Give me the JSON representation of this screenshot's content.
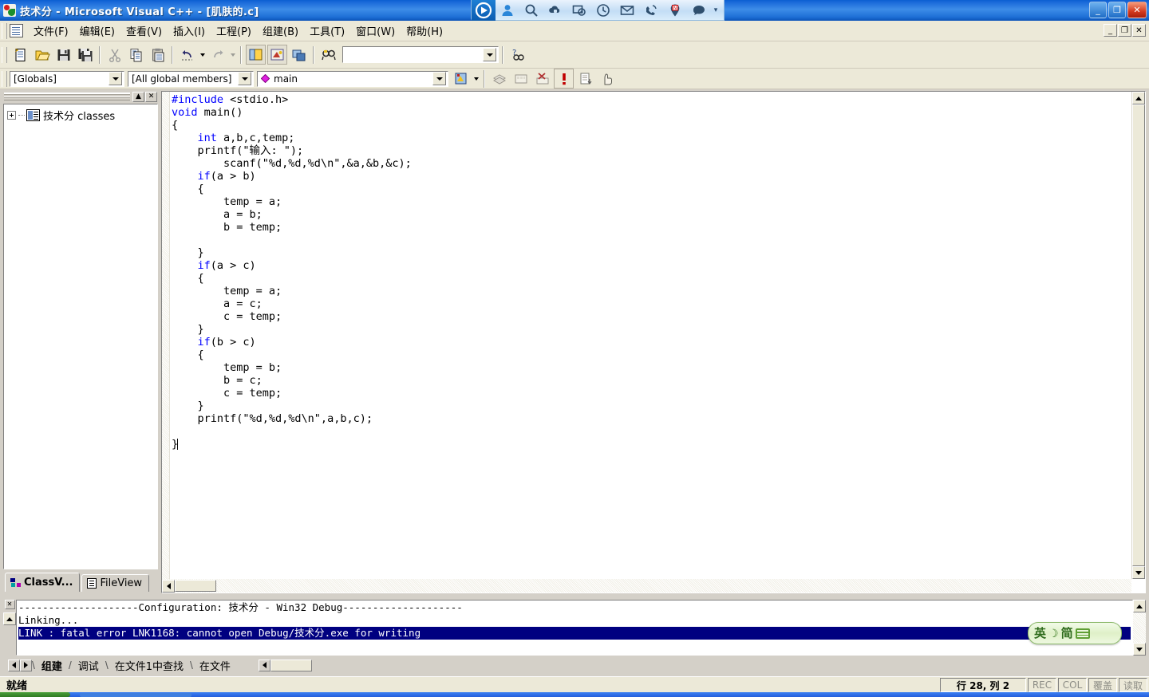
{
  "window": {
    "title": "技术分 - Microsoft Visual C++ - [肌肤的.c]",
    "app_icon": "vc-app-icon",
    "minimize_label": "_",
    "maximize_label": "❐",
    "close_label": "✕",
    "mdi_minimize_label": "_",
    "mdi_restore_label": "❐",
    "mdi_close_label": "✕"
  },
  "qq_toolbar": {
    "icons": [
      {
        "name": "qq-logo-icon",
        "label": "QQ"
      },
      {
        "name": "contact-icon",
        "label": "联系人"
      },
      {
        "name": "search-icon",
        "label": "搜索"
      },
      {
        "name": "cloud-lock-icon",
        "label": "安全"
      },
      {
        "name": "screenshot-icon",
        "label": "截图"
      },
      {
        "name": "clock-icon",
        "label": "时钟"
      },
      {
        "name": "mail-icon",
        "label": "邮件"
      },
      {
        "name": "phone-icon",
        "label": "电话"
      },
      {
        "name": "news-icon",
        "label": "新闻"
      },
      {
        "name": "chat-icon",
        "label": "聊天"
      }
    ],
    "caret_label": "▾"
  },
  "menubar": {
    "items": [
      {
        "label": "文件(F)"
      },
      {
        "label": "编辑(E)"
      },
      {
        "label": "查看(V)"
      },
      {
        "label": "插入(I)"
      },
      {
        "label": "工程(P)"
      },
      {
        "label": "组建(B)"
      },
      {
        "label": "工具(T)"
      },
      {
        "label": "窗口(W)"
      },
      {
        "label": "帮助(H)"
      }
    ]
  },
  "standard_toolbar": {
    "buttons": [
      {
        "name": "new-text-file-button",
        "title": "新建"
      },
      {
        "name": "open-button",
        "title": "打开"
      },
      {
        "name": "save-button",
        "title": "保存"
      },
      {
        "name": "save-all-button",
        "title": "全部保存"
      },
      {
        "name": "cut-button",
        "title": "剪切"
      },
      {
        "name": "copy-button",
        "title": "复制"
      },
      {
        "name": "paste-button",
        "title": "粘贴"
      },
      {
        "name": "undo-button",
        "title": "撤销"
      },
      {
        "name": "redo-button",
        "title": "重做"
      },
      {
        "name": "workspace-toggle-button",
        "title": "工作区"
      },
      {
        "name": "output-toggle-button",
        "title": "输出"
      },
      {
        "name": "window-list-button",
        "title": "窗口列表"
      },
      {
        "name": "find-in-files-button",
        "title": "在文件中查找"
      },
      {
        "name": "help-search-button",
        "title": "搜索帮助"
      }
    ],
    "find_combo_value": "",
    "find_combo_placeholder": ""
  },
  "wizardbar": {
    "class_combo_value": "[Globals]",
    "members_combo_value": "[All global members]",
    "function_combo_value": "main",
    "function_icon": "member-function-icon",
    "action_button": "wizardbar-action-button"
  },
  "build_toolbar": {
    "buttons": [
      {
        "name": "compile-button",
        "enabled": false
      },
      {
        "name": "build-button",
        "enabled": false
      },
      {
        "name": "stop-build-button",
        "enabled": false
      },
      {
        "name": "execute-program-button",
        "enabled": true
      },
      {
        "name": "go-button",
        "enabled": false
      },
      {
        "name": "insert-breakpoint-button",
        "enabled": false
      }
    ]
  },
  "workspace": {
    "caption_buttons": {
      "minimize": "▲",
      "close": "✕"
    },
    "tree": {
      "expander": "+",
      "icon": "class-folder-icon",
      "label": "技术分 classes"
    },
    "tabs": [
      {
        "label": "ClassV...",
        "icon": "classview-icon",
        "active": true
      },
      {
        "label": "FileView",
        "icon": "fileview-icon",
        "active": false
      }
    ]
  },
  "editor": {
    "filename": "肌肤的.c",
    "lines": [
      [
        {
          "t": "#include",
          "c": "pp"
        },
        {
          "t": " <stdio.h>",
          "c": ""
        }
      ],
      [
        {
          "t": "void",
          "c": "kw"
        },
        {
          "t": " main()",
          "c": ""
        }
      ],
      [
        {
          "t": "{",
          "c": ""
        }
      ],
      [
        {
          "t": "    ",
          "c": ""
        },
        {
          "t": "int",
          "c": "kw"
        },
        {
          "t": " a,b,c,temp;",
          "c": ""
        }
      ],
      [
        {
          "t": "    printf(\"输入: \");",
          "c": ""
        }
      ],
      [
        {
          "t": "        scanf(\"%d,%d,%d\\n\",&a,&b,&c);",
          "c": ""
        }
      ],
      [
        {
          "t": "    ",
          "c": ""
        },
        {
          "t": "if",
          "c": "kw"
        },
        {
          "t": "(a > b)",
          "c": ""
        }
      ],
      [
        {
          "t": "    {",
          "c": ""
        }
      ],
      [
        {
          "t": "        temp = a;",
          "c": ""
        }
      ],
      [
        {
          "t": "        a = b;",
          "c": ""
        }
      ],
      [
        {
          "t": "        b = temp;",
          "c": ""
        }
      ],
      [
        {
          "t": "",
          "c": ""
        }
      ],
      [
        {
          "t": "    }",
          "c": ""
        }
      ],
      [
        {
          "t": "    ",
          "c": ""
        },
        {
          "t": "if",
          "c": "kw"
        },
        {
          "t": "(a > c)",
          "c": ""
        }
      ],
      [
        {
          "t": "    {",
          "c": ""
        }
      ],
      [
        {
          "t": "        temp = a;",
          "c": ""
        }
      ],
      [
        {
          "t": "        a = c;",
          "c": ""
        }
      ],
      [
        {
          "t": "        c = temp;",
          "c": ""
        }
      ],
      [
        {
          "t": "    }",
          "c": ""
        }
      ],
      [
        {
          "t": "    ",
          "c": ""
        },
        {
          "t": "if",
          "c": "kw"
        },
        {
          "t": "(b > c)",
          "c": ""
        }
      ],
      [
        {
          "t": "    {",
          "c": ""
        }
      ],
      [
        {
          "t": "        temp = b;",
          "c": ""
        }
      ],
      [
        {
          "t": "        b = c;",
          "c": ""
        }
      ],
      [
        {
          "t": "        c = temp;",
          "c": ""
        }
      ],
      [
        {
          "t": "    }",
          "c": ""
        }
      ],
      [
        {
          "t": "    printf(\"%d,%d,%d\\n\",a,b,c);",
          "c": ""
        }
      ],
      [
        {
          "t": "",
          "c": ""
        }
      ],
      [
        {
          "t": "}",
          "c": "",
          "caret": true
        }
      ]
    ]
  },
  "output": {
    "close_button": "✕",
    "lines": [
      {
        "text": "--------------------Configuration: 技术分 - Win32 Debug--------------------",
        "selected": false
      },
      {
        "text": "Linking...",
        "selected": false
      },
      {
        "text": "LINK : fatal error LNK1168: cannot open Debug/技术分.exe for writing",
        "selected": true
      }
    ],
    "tabs": [
      {
        "label": "组建",
        "active": true
      },
      {
        "label": "调试",
        "active": false
      },
      {
        "label": "在文件1中查找",
        "active": false
      },
      {
        "label": "在文件",
        "active": false
      }
    ]
  },
  "statusbar": {
    "message": "就绪",
    "position": "行 28, 列 2",
    "indicators": [
      {
        "label": "REC",
        "enabled": false
      },
      {
        "label": "COL",
        "enabled": false
      },
      {
        "label": "覆盖",
        "enabled": false
      },
      {
        "label": "读取",
        "enabled": false
      }
    ]
  },
  "ime_bar": {
    "mode": "英",
    "punctuation_icon": "moon-icon",
    "script": "简",
    "keyboard_icon": "keyboard-icon"
  },
  "colors": {
    "titlebar_blue": "#1666d8",
    "chrome": "#ece9d8",
    "face": "#d4d0c8",
    "keyword_blue": "#0000ff",
    "selection_navy": "#000080",
    "ime_green": "#2f6b1d"
  }
}
